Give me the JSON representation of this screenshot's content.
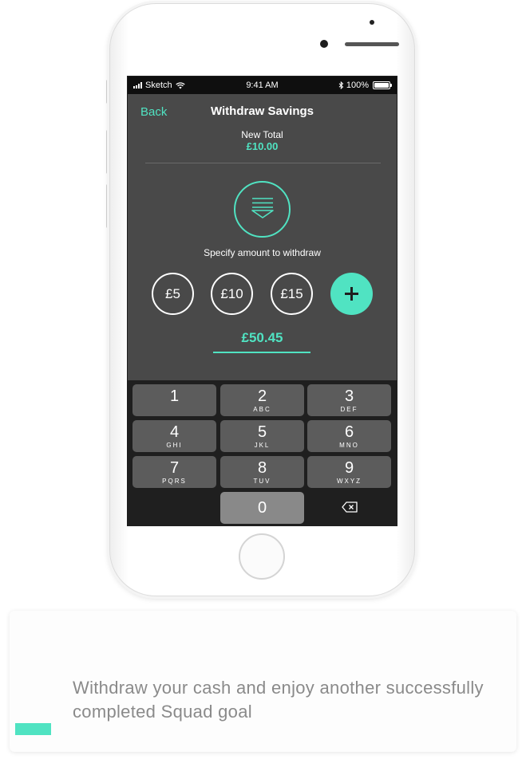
{
  "status_bar": {
    "carrier": "Sketch",
    "time": "9:41 AM",
    "battery": "100%"
  },
  "nav": {
    "back_label": "Back",
    "title": "Withdraw Savings"
  },
  "summary": {
    "new_total_label": "New Total",
    "new_total_value": "£10.00"
  },
  "prompt": "Specify amount to withdraw",
  "quick_amounts": [
    "£5",
    "£10",
    "£15"
  ],
  "amount_input_value": "£50.45",
  "keypad": {
    "keys": [
      {
        "digit": "1",
        "letters": ""
      },
      {
        "digit": "2",
        "letters": "ABC"
      },
      {
        "digit": "3",
        "letters": "DEF"
      },
      {
        "digit": "4",
        "letters": "GHI"
      },
      {
        "digit": "5",
        "letters": "JKL"
      },
      {
        "digit": "6",
        "letters": "MNO"
      },
      {
        "digit": "7",
        "letters": "PQRS"
      },
      {
        "digit": "8",
        "letters": "TUV"
      },
      {
        "digit": "9",
        "letters": "WXYZ"
      },
      {
        "digit": "0",
        "letters": ""
      }
    ]
  },
  "caption": {
    "text": "Withdraw your cash and enjoy another successfully completed Squad goal"
  },
  "colors": {
    "accent": "#50e3c2",
    "screen_background": "#494949",
    "keypad_background": "#1f1f1f"
  },
  "icons": [
    "withdraw-icon",
    "plus-icon",
    "backspace-icon",
    "wifi-icon",
    "bluetooth-icon",
    "battery-icon"
  ]
}
